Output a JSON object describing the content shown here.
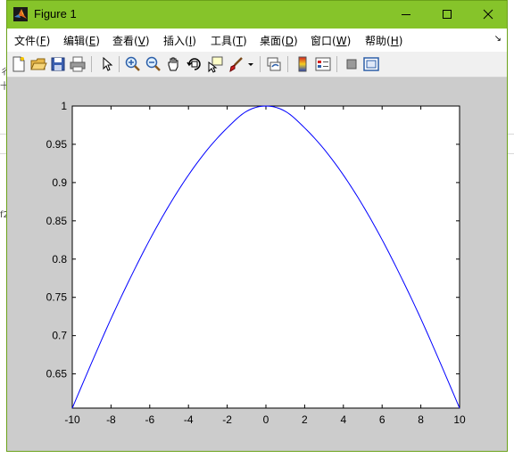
{
  "window": {
    "title": "Figure 1"
  },
  "menu": {
    "items": [
      {
        "label": "文件(",
        "key": "F",
        "tail": ")"
      },
      {
        "label": "编辑(",
        "key": "E",
        "tail": ")"
      },
      {
        "label": "查看(",
        "key": "V",
        "tail": ")"
      },
      {
        "label": "插入(",
        "key": "I",
        "tail": ")"
      },
      {
        "label": "工具(",
        "key": "T",
        "tail": ")"
      },
      {
        "label": "桌面(",
        "key": "D",
        "tail": ")"
      },
      {
        "label": "窗口(",
        "key": "W",
        "tail": ")"
      },
      {
        "label": "帮助(",
        "key": "H",
        "tail": ")"
      }
    ],
    "overflow_arrow": "↘"
  },
  "toolbar": {
    "icons": [
      "new-figure-icon",
      "open-file-icon",
      "save-icon",
      "print-icon",
      "pointer-icon",
      "zoom-in-icon",
      "zoom-out-icon",
      "pan-hand-icon",
      "rotate-3d-icon",
      "data-cursor-icon",
      "brush-icon",
      "link-icon",
      "colorbar-icon",
      "legend-icon",
      "hide-plot-tools-icon",
      "show-plot-tools-icon"
    ]
  },
  "background_fragments": [
    "彳",
    "十",
    "f2"
  ],
  "colors": {
    "titlebar": "#86c42a",
    "figure_bg": "#cccccc",
    "line": "#0000ff"
  },
  "chart_data": {
    "type": "line",
    "title": "",
    "xlabel": "",
    "ylabel": "",
    "xlim": [
      -10,
      10
    ],
    "ylim": [
      0.6053,
      1
    ],
    "xticks": [
      "-10",
      "-8",
      "-6",
      "-4",
      "-2",
      "0",
      "2",
      "4",
      "6",
      "8",
      "10"
    ],
    "yticks": [
      "0.65",
      "0.7",
      "0.75",
      "0.8",
      "0.85",
      "0.9",
      "0.95",
      "1"
    ],
    "grid": false,
    "legend": "none",
    "series": [
      {
        "x": [
          -10,
          -9,
          -8,
          -7,
          -6,
          -5,
          -4,
          -3,
          -2,
          -1,
          0,
          1,
          2,
          3,
          4,
          5,
          6,
          7,
          8,
          9,
          10
        ],
        "y": [
          0.6053,
          0.6646,
          0.7221,
          0.7755,
          0.8253,
          0.8702,
          0.9098,
          0.9437,
          0.9714,
          0.9931,
          1.0,
          0.9931,
          0.9714,
          0.9437,
          0.9098,
          0.8702,
          0.8253,
          0.7755,
          0.7221,
          0.6646,
          0.6053
        ]
      }
    ]
  }
}
